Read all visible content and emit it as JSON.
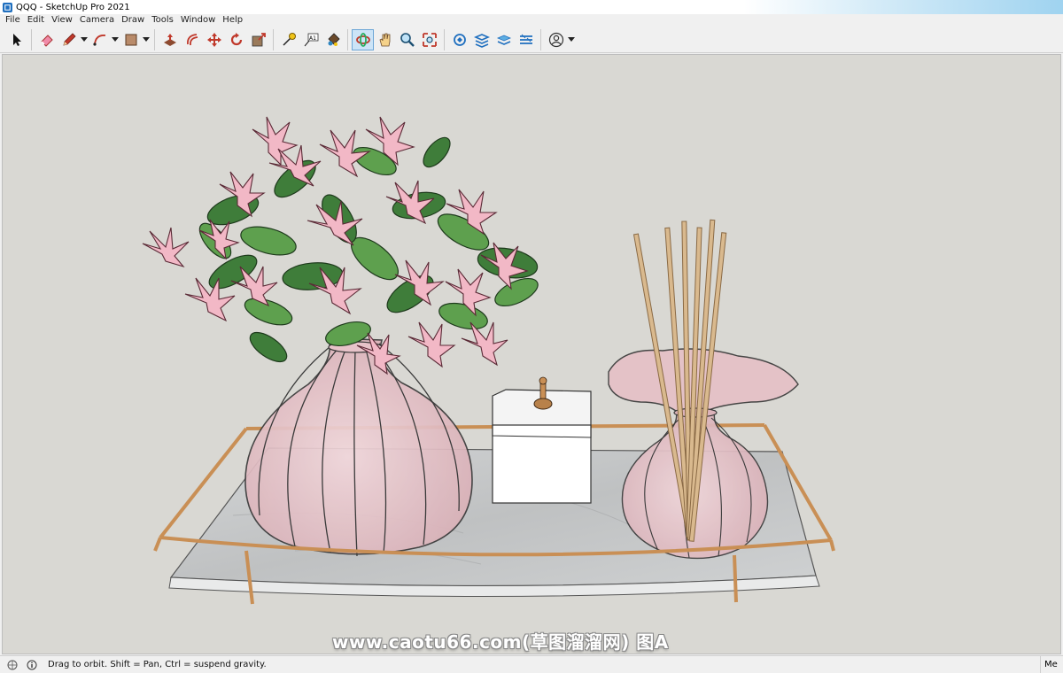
{
  "window": {
    "title": "QQQ - SketchUp Pro 2021",
    "app_icon": "sketchup-logo-icon"
  },
  "menu": {
    "items": [
      {
        "label": "File"
      },
      {
        "label": "Edit"
      },
      {
        "label": "View"
      },
      {
        "label": "Camera"
      },
      {
        "label": "Draw"
      },
      {
        "label": "Tools"
      },
      {
        "label": "Window"
      },
      {
        "label": "Help"
      }
    ]
  },
  "toolbar": {
    "tools": [
      {
        "name": "select-tool",
        "icon": "arrow-cursor-icon"
      },
      {
        "name": "eraser-tool",
        "icon": "eraser-icon"
      },
      {
        "name": "line-tool",
        "icon": "pencil-icon",
        "has_dropdown": true
      },
      {
        "name": "arc-tool",
        "icon": "arc-icon",
        "has_dropdown": true
      },
      {
        "name": "rectangle-tool",
        "icon": "rectangle-icon",
        "has_dropdown": true
      },
      {
        "name": "push-pull-tool",
        "icon": "push-pull-icon"
      },
      {
        "name": "offset-tool",
        "icon": "offset-icon"
      },
      {
        "name": "move-tool",
        "icon": "move-icon"
      },
      {
        "name": "rotate-tool",
        "icon": "rotate-icon"
      },
      {
        "name": "scale-tool",
        "icon": "scale-icon"
      },
      {
        "name": "tape-measure-tool",
        "icon": "tape-measure-icon"
      },
      {
        "name": "text-tool",
        "icon": "text-icon",
        "label": "A1"
      },
      {
        "name": "paint-bucket-tool",
        "icon": "paint-bucket-icon"
      },
      {
        "name": "orbit-tool",
        "icon": "orbit-icon",
        "active": true
      },
      {
        "name": "pan-tool",
        "icon": "hand-icon"
      },
      {
        "name": "zoom-tool",
        "icon": "magnifier-icon"
      },
      {
        "name": "zoom-extents-tool",
        "icon": "zoom-extents-icon"
      },
      {
        "name": "warehouse-tool",
        "icon": "3d-warehouse-icon"
      },
      {
        "name": "extension-warehouse-tool",
        "icon": "extension-warehouse-icon"
      },
      {
        "name": "layout-tool",
        "icon": "layers-icon"
      },
      {
        "name": "extension-manager-tool",
        "icon": "extension-manager-icon"
      },
      {
        "name": "account-tool",
        "icon": "account-icon",
        "has_dropdown": true
      }
    ]
  },
  "viewport": {
    "background": "#d9d8d3",
    "watermark": "www.caotu66.com(草图溜溜网) 图A"
  },
  "status": {
    "message": "Drag to orbit. Shift = Pan, Ctrl = suspend gravity.",
    "right_label": "Me"
  },
  "colors": {
    "petal": "#f2b8c6",
    "petal_dark": "#e799ad",
    "leaf": "#3f7d3a",
    "leaf_light": "#5ea04e",
    "vase_glass": "#e9c6cc",
    "gold_frame": "#c98f55",
    "marble": "#c7c9ca",
    "box": "#ffffff",
    "reed": "#d9b98e"
  }
}
